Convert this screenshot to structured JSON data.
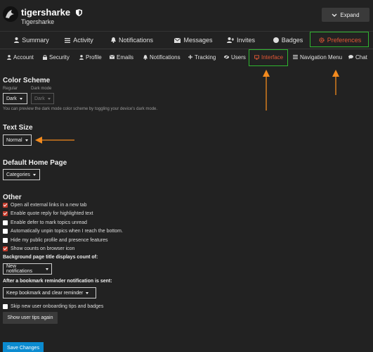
{
  "header": {
    "username": "tigersharke",
    "full_name": "Tigersharke",
    "expand_label": "Expand"
  },
  "main_nav": [
    {
      "label": "Summary",
      "icon": "user-icon"
    },
    {
      "label": "Activity",
      "icon": "list-icon"
    },
    {
      "label": "Notifications",
      "icon": "bell-icon"
    },
    {
      "label": "Messages",
      "icon": "envelope-icon"
    },
    {
      "label": "Invites",
      "icon": "user-plus-icon"
    },
    {
      "label": "Badges",
      "icon": "circle-icon"
    },
    {
      "label": "Preferences",
      "icon": "gear-icon",
      "active": true
    }
  ],
  "sub_nav": [
    {
      "label": "Account",
      "icon": "user-icon"
    },
    {
      "label": "Security",
      "icon": "lock-icon"
    },
    {
      "label": "Profile",
      "icon": "user-icon"
    },
    {
      "label": "Emails",
      "icon": "envelope-icon"
    },
    {
      "label": "Notifications",
      "icon": "bell-icon"
    },
    {
      "label": "Tracking",
      "icon": "plus-icon"
    },
    {
      "label": "Users",
      "icon": "eye-slash-icon"
    },
    {
      "label": "Interface",
      "icon": "desktop-icon",
      "active": true
    },
    {
      "label": "Navigation Menu",
      "icon": "bars-icon"
    },
    {
      "label": "Chat",
      "icon": "comment-icon"
    }
  ],
  "color_scheme": {
    "title": "Color Scheme",
    "regular_label": "Regular",
    "regular_value": "Dark",
    "dark_mode_label": "Dark mode",
    "dark_mode_value": "Dark",
    "hint": "You can preview the dark mode color scheme by toggling your device's dark mode."
  },
  "text_size": {
    "title": "Text Size",
    "value": "Normal"
  },
  "default_home": {
    "title": "Default Home Page",
    "value": "Categories"
  },
  "other": {
    "title": "Other",
    "options": [
      {
        "label": "Open all external links in a new tab",
        "checked": true
      },
      {
        "label": "Enable quote reply for highlighted text",
        "checked": true
      },
      {
        "label": "Enable defer to mark topics unread",
        "checked": false
      },
      {
        "label": "Automatically unpin topics when I reach the bottom.",
        "checked": false
      },
      {
        "label": "Hide my public profile and presence features",
        "checked": false
      },
      {
        "label": "Show counts on browser icon",
        "checked": true
      }
    ],
    "bg_title_label": "Background page title displays count of:",
    "bg_title_value": "New notifications",
    "bookmark_label": "After a bookmark reminder notification is sent:",
    "bookmark_value": "Keep bookmark and clear reminder",
    "skip_tips_label": "Skip new user onboarding tips and badges",
    "skip_tips_checked": false,
    "show_tips_button": "Show user tips again",
    "save_button": "Save Changes"
  },
  "colors": {
    "background": "#222222",
    "accent": "#e45735",
    "highlight_box": "#2fb52f",
    "annotation_arrow": "#f28a1e",
    "save_button": "#0b8bd0"
  }
}
